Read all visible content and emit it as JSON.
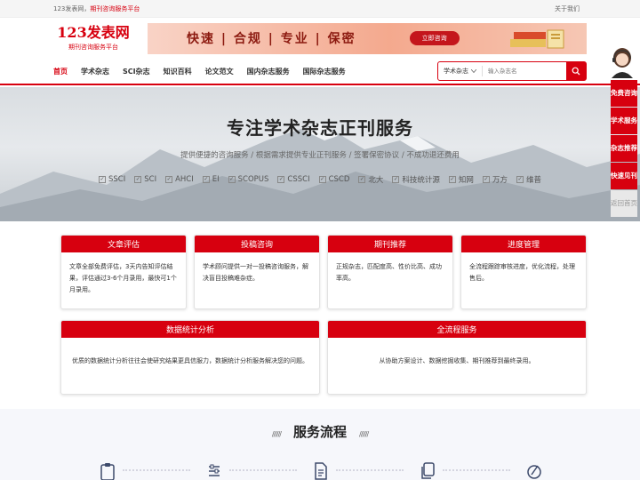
{
  "topbar": {
    "site": "123发表网",
    "sep": "，",
    "slogan": "期刊咨询服务平台",
    "about": "关于我们"
  },
  "header": {
    "logo_title": "123发表网",
    "logo_subtitle": "期刊咨询服务平台",
    "banner_slogan": "快速 | 合规 | 专业 | 保密",
    "banner_button": "立即咨询"
  },
  "nav": {
    "items": [
      "首页",
      "学术杂志",
      "SCI杂志",
      "知识百科",
      "论文范文",
      "国内杂志服务",
      "国际杂志服务"
    ],
    "search_select": "学术杂志",
    "search_placeholder": "输入杂志名"
  },
  "hero": {
    "title": "专注学术杂志正刊服务",
    "subtitle": "提供便捷的咨询服务 / 根据需求提供专业正刊服务 / 签署保密协议 / 不成功退还费用",
    "tags": [
      "SSCI",
      "SCI",
      "AHCI",
      "EI",
      "SCOPUS",
      "CSSCI",
      "CSCD",
      "北大",
      "科技统计源",
      "知网",
      "万方",
      "维普"
    ]
  },
  "cards": {
    "row1": [
      {
        "title": "文章评估",
        "body": "文章全部免费评估，3天内告知评估结果，评估通过3-6个月录用，最快可1个月录用。"
      },
      {
        "title": "投稿咨询",
        "body": "学术顾问提供一对一投稿咨询服务，解决盲目投稿难杂症。"
      },
      {
        "title": "期刊推荐",
        "body": "正规杂志，匹配度高、性价比高、成功率高。"
      },
      {
        "title": "进度管理",
        "body": "全流程跟踪审核进度，优化流程，处理售后。"
      }
    ],
    "row2": [
      {
        "title": "数据统计分析",
        "body": "优质的数据统计分析往往会使研究结果更具信服力，数据统计分析服务解决您的问题。"
      },
      {
        "title": "全流程服务",
        "body": "从协助方案设计、数据挖掘收集、期刊推荐到最终录用。"
      }
    ]
  },
  "sidebar": {
    "buttons": [
      {
        "label": "免费咨询"
      },
      {
        "label": "学术服务"
      },
      {
        "label": "杂志推荐"
      },
      {
        "label": "快速见刊"
      },
      {
        "label": "返回首页"
      }
    ]
  },
  "flow": {
    "title": "服务流程",
    "slash": "//////"
  },
  "colors": {
    "brand": "#d7000f"
  }
}
